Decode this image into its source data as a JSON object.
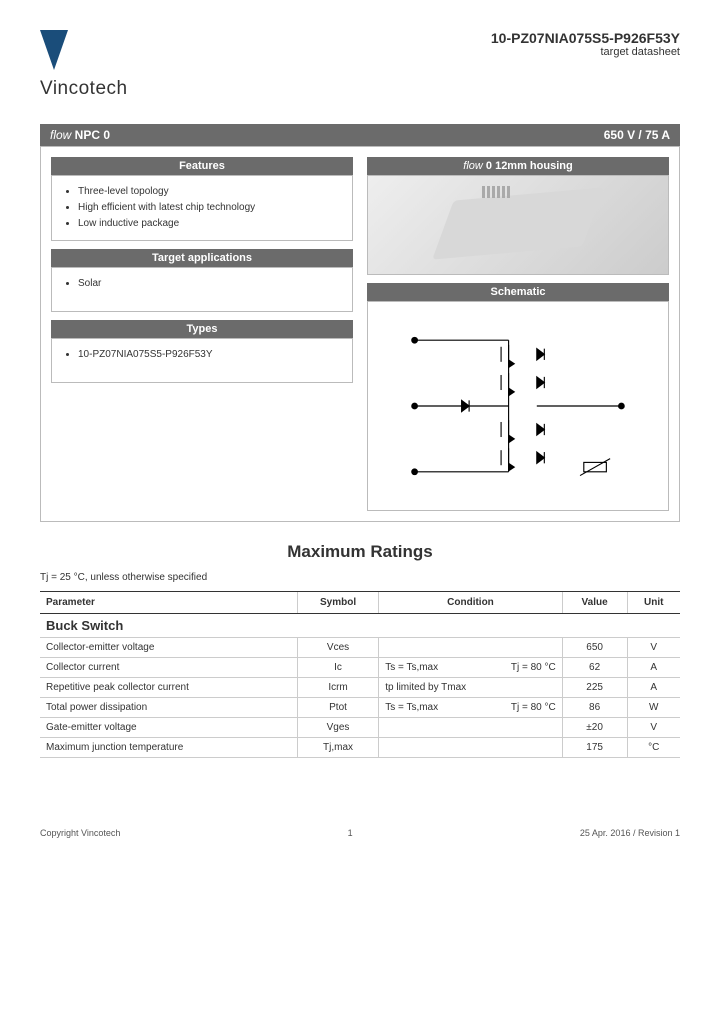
{
  "header": {
    "company": "Vincotech",
    "part_number": "10-PZ07NIA075S5-P926F53Y",
    "subtitle": "target datasheet"
  },
  "product_bar": {
    "flow_prefix": "flow",
    "flow_name": " NPC 0",
    "rating": "650 V / 75 A"
  },
  "sections": {
    "features_title": "Features",
    "features": [
      "Three-level topology",
      "High efficient with latest chip technology",
      "Low inductive package"
    ],
    "apps_title": "Target applications",
    "apps": [
      "Solar"
    ],
    "types_title": "Types",
    "types": [
      "10-PZ07NIA075S5-P926F53Y"
    ],
    "housing_prefix": "flow",
    "housing_title": " 0 12mm housing",
    "schematic_title": "Schematic"
  },
  "ratings": {
    "title": "Maximum Ratings",
    "note": "Tj = 25 °C, unless otherwise specified",
    "headers": {
      "param": "Parameter",
      "symbol": "Symbol",
      "condition": "Condition",
      "value": "Value",
      "unit": "Unit"
    },
    "section1": "Buck Switch",
    "rows": [
      {
        "param": "Collector-emitter voltage",
        "sym": "Vces",
        "cond_l": "",
        "cond_r": "",
        "val": "650",
        "unit": "V"
      },
      {
        "param": "Collector current",
        "sym": "Ic",
        "cond_l": "Ts = Ts,max",
        "cond_r": "Tj = 80 °C",
        "val": "62",
        "unit": "A"
      },
      {
        "param": "Repetitive peak collector current",
        "sym": "Icrm",
        "cond_l": "tp limited by Tmax",
        "cond_r": "",
        "val": "225",
        "unit": "A"
      },
      {
        "param": "Total power dissipation",
        "sym": "Ptot",
        "cond_l": "Ts = Ts,max",
        "cond_r": "Tj = 80 °C",
        "val": "86",
        "unit": "W"
      },
      {
        "param": "Gate-emitter voltage",
        "sym": "Vges",
        "cond_l": "",
        "cond_r": "",
        "val": "±20",
        "unit": "V"
      },
      {
        "param": "Maximum junction temperature",
        "sym": "Tj,max",
        "cond_l": "",
        "cond_r": "",
        "val": "175",
        "unit": "°C"
      }
    ]
  },
  "footer": {
    "left": "Copyright Vincotech",
    "center": "1",
    "right": "25 Apr. 2016 / Revision 1"
  }
}
